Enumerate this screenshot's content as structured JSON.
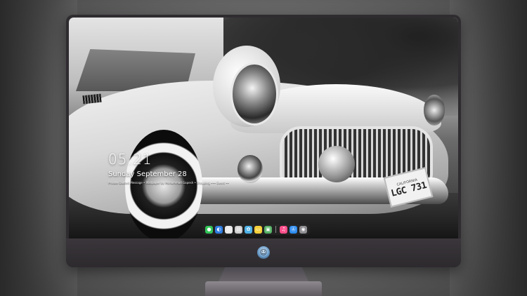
{
  "lock_screen": {
    "time": "05:21",
    "date": "Sunday September 28",
    "subline": "Private Quoted Message • Wallpaper by Mohammad Gapesh • Shopping ••• Event ••"
  },
  "wallpaper": {
    "plate_state": "CALIFORNIA",
    "plate_number": "LGC 731"
  },
  "dock": {
    "icons": [
      {
        "name": "messages-icon",
        "glyph": "●",
        "color": "#34c759"
      },
      {
        "name": "finder-icon",
        "glyph": "◐",
        "color": "#2f7de1"
      },
      {
        "name": "safari-icon",
        "glyph": "◎",
        "color": "#e8e8e8"
      },
      {
        "name": "terminal-icon",
        "glyph": "▤",
        "color": "#cfcfcf"
      },
      {
        "name": "photos-icon",
        "glyph": "✿",
        "color": "#4fb3e8"
      },
      {
        "name": "notes-icon",
        "glyph": "▭",
        "color": "#f5d03b"
      },
      {
        "name": "preview-icon",
        "glyph": "▣",
        "color": "#58b368"
      },
      {
        "name": "music-icon",
        "glyph": "♫",
        "color": "#ff4f8b"
      },
      {
        "name": "app-store-icon",
        "glyph": "Ⓐ",
        "color": "#2e8cf0"
      },
      {
        "name": "camera-icon",
        "glyph": "◉",
        "color": "#8e8e93"
      }
    ]
  },
  "monitor": {
    "chin_logo_icon": "alien-icon"
  }
}
